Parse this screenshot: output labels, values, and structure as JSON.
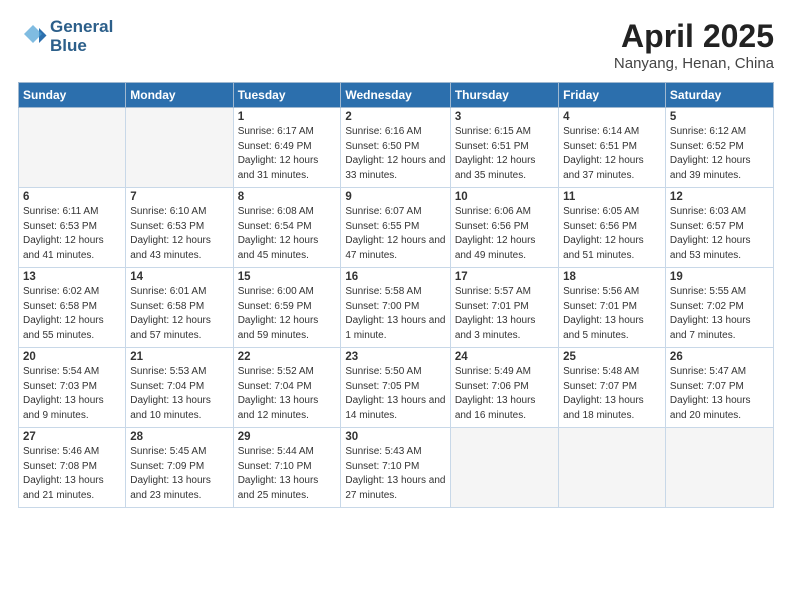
{
  "header": {
    "logo_line1": "General",
    "logo_line2": "Blue",
    "month_title": "April 2025",
    "location": "Nanyang, Henan, China"
  },
  "weekdays": [
    "Sunday",
    "Monday",
    "Tuesday",
    "Wednesday",
    "Thursday",
    "Friday",
    "Saturday"
  ],
  "weeks": [
    [
      {
        "num": "",
        "sunrise": "",
        "sunset": "",
        "daylight": "",
        "empty": true
      },
      {
        "num": "",
        "sunrise": "",
        "sunset": "",
        "daylight": "",
        "empty": true
      },
      {
        "num": "1",
        "sunrise": "Sunrise: 6:17 AM",
        "sunset": "Sunset: 6:49 PM",
        "daylight": "Daylight: 12 hours and 31 minutes."
      },
      {
        "num": "2",
        "sunrise": "Sunrise: 6:16 AM",
        "sunset": "Sunset: 6:50 PM",
        "daylight": "Daylight: 12 hours and 33 minutes."
      },
      {
        "num": "3",
        "sunrise": "Sunrise: 6:15 AM",
        "sunset": "Sunset: 6:51 PM",
        "daylight": "Daylight: 12 hours and 35 minutes."
      },
      {
        "num": "4",
        "sunrise": "Sunrise: 6:14 AM",
        "sunset": "Sunset: 6:51 PM",
        "daylight": "Daylight: 12 hours and 37 minutes."
      },
      {
        "num": "5",
        "sunrise": "Sunrise: 6:12 AM",
        "sunset": "Sunset: 6:52 PM",
        "daylight": "Daylight: 12 hours and 39 minutes."
      }
    ],
    [
      {
        "num": "6",
        "sunrise": "Sunrise: 6:11 AM",
        "sunset": "Sunset: 6:53 PM",
        "daylight": "Daylight: 12 hours and 41 minutes."
      },
      {
        "num": "7",
        "sunrise": "Sunrise: 6:10 AM",
        "sunset": "Sunset: 6:53 PM",
        "daylight": "Daylight: 12 hours and 43 minutes."
      },
      {
        "num": "8",
        "sunrise": "Sunrise: 6:08 AM",
        "sunset": "Sunset: 6:54 PM",
        "daylight": "Daylight: 12 hours and 45 minutes."
      },
      {
        "num": "9",
        "sunrise": "Sunrise: 6:07 AM",
        "sunset": "Sunset: 6:55 PM",
        "daylight": "Daylight: 12 hours and 47 minutes."
      },
      {
        "num": "10",
        "sunrise": "Sunrise: 6:06 AM",
        "sunset": "Sunset: 6:56 PM",
        "daylight": "Daylight: 12 hours and 49 minutes."
      },
      {
        "num": "11",
        "sunrise": "Sunrise: 6:05 AM",
        "sunset": "Sunset: 6:56 PM",
        "daylight": "Daylight: 12 hours and 51 minutes."
      },
      {
        "num": "12",
        "sunrise": "Sunrise: 6:03 AM",
        "sunset": "Sunset: 6:57 PM",
        "daylight": "Daylight: 12 hours and 53 minutes."
      }
    ],
    [
      {
        "num": "13",
        "sunrise": "Sunrise: 6:02 AM",
        "sunset": "Sunset: 6:58 PM",
        "daylight": "Daylight: 12 hours and 55 minutes."
      },
      {
        "num": "14",
        "sunrise": "Sunrise: 6:01 AM",
        "sunset": "Sunset: 6:58 PM",
        "daylight": "Daylight: 12 hours and 57 minutes."
      },
      {
        "num": "15",
        "sunrise": "Sunrise: 6:00 AM",
        "sunset": "Sunset: 6:59 PM",
        "daylight": "Daylight: 12 hours and 59 minutes."
      },
      {
        "num": "16",
        "sunrise": "Sunrise: 5:58 AM",
        "sunset": "Sunset: 7:00 PM",
        "daylight": "Daylight: 13 hours and 1 minute."
      },
      {
        "num": "17",
        "sunrise": "Sunrise: 5:57 AM",
        "sunset": "Sunset: 7:01 PM",
        "daylight": "Daylight: 13 hours and 3 minutes."
      },
      {
        "num": "18",
        "sunrise": "Sunrise: 5:56 AM",
        "sunset": "Sunset: 7:01 PM",
        "daylight": "Daylight: 13 hours and 5 minutes."
      },
      {
        "num": "19",
        "sunrise": "Sunrise: 5:55 AM",
        "sunset": "Sunset: 7:02 PM",
        "daylight": "Daylight: 13 hours and 7 minutes."
      }
    ],
    [
      {
        "num": "20",
        "sunrise": "Sunrise: 5:54 AM",
        "sunset": "Sunset: 7:03 PM",
        "daylight": "Daylight: 13 hours and 9 minutes."
      },
      {
        "num": "21",
        "sunrise": "Sunrise: 5:53 AM",
        "sunset": "Sunset: 7:04 PM",
        "daylight": "Daylight: 13 hours and 10 minutes."
      },
      {
        "num": "22",
        "sunrise": "Sunrise: 5:52 AM",
        "sunset": "Sunset: 7:04 PM",
        "daylight": "Daylight: 13 hours and 12 minutes."
      },
      {
        "num": "23",
        "sunrise": "Sunrise: 5:50 AM",
        "sunset": "Sunset: 7:05 PM",
        "daylight": "Daylight: 13 hours and 14 minutes."
      },
      {
        "num": "24",
        "sunrise": "Sunrise: 5:49 AM",
        "sunset": "Sunset: 7:06 PM",
        "daylight": "Daylight: 13 hours and 16 minutes."
      },
      {
        "num": "25",
        "sunrise": "Sunrise: 5:48 AM",
        "sunset": "Sunset: 7:07 PM",
        "daylight": "Daylight: 13 hours and 18 minutes."
      },
      {
        "num": "26",
        "sunrise": "Sunrise: 5:47 AM",
        "sunset": "Sunset: 7:07 PM",
        "daylight": "Daylight: 13 hours and 20 minutes."
      }
    ],
    [
      {
        "num": "27",
        "sunrise": "Sunrise: 5:46 AM",
        "sunset": "Sunset: 7:08 PM",
        "daylight": "Daylight: 13 hours and 21 minutes."
      },
      {
        "num": "28",
        "sunrise": "Sunrise: 5:45 AM",
        "sunset": "Sunset: 7:09 PM",
        "daylight": "Daylight: 13 hours and 23 minutes."
      },
      {
        "num": "29",
        "sunrise": "Sunrise: 5:44 AM",
        "sunset": "Sunset: 7:10 PM",
        "daylight": "Daylight: 13 hours and 25 minutes."
      },
      {
        "num": "30",
        "sunrise": "Sunrise: 5:43 AM",
        "sunset": "Sunset: 7:10 PM",
        "daylight": "Daylight: 13 hours and 27 minutes."
      },
      {
        "num": "",
        "sunrise": "",
        "sunset": "",
        "daylight": "",
        "empty": true
      },
      {
        "num": "",
        "sunrise": "",
        "sunset": "",
        "daylight": "",
        "empty": true
      },
      {
        "num": "",
        "sunrise": "",
        "sunset": "",
        "daylight": "",
        "empty": true
      }
    ]
  ]
}
